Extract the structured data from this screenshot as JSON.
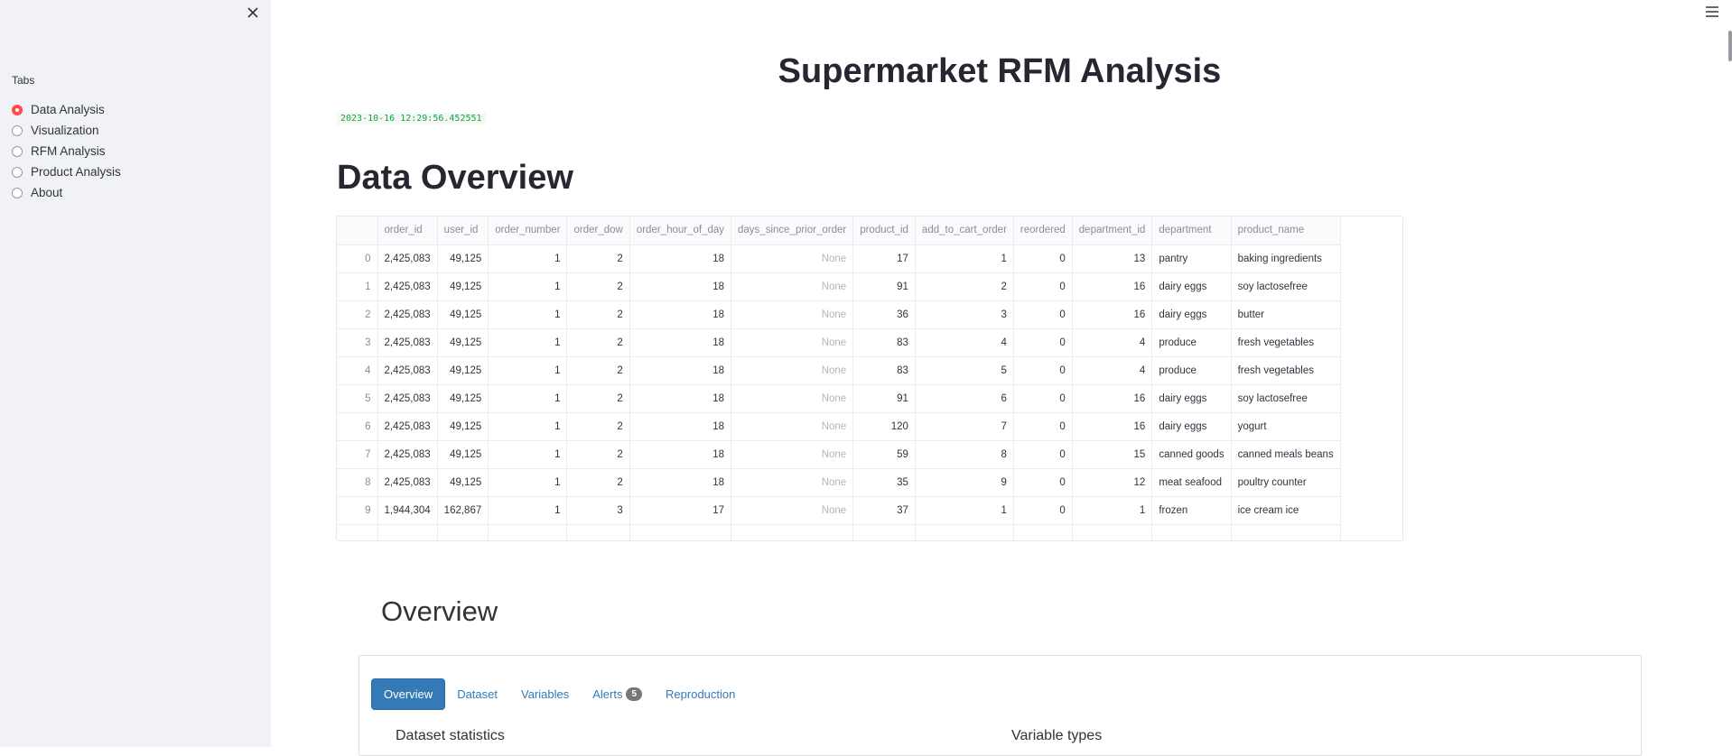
{
  "sidebar": {
    "tabs_label": "Tabs",
    "items": [
      {
        "label": "Data Analysis",
        "selected": true
      },
      {
        "label": "Visualization",
        "selected": false
      },
      {
        "label": "RFM Analysis",
        "selected": false
      },
      {
        "label": "Product Analysis",
        "selected": false
      },
      {
        "label": "About",
        "selected": false
      }
    ]
  },
  "main": {
    "title": "Supermarket RFM Analysis",
    "timestamp": "2023-10-16 12:29:56.452551",
    "section_title": "Data Overview"
  },
  "table": {
    "columns": [
      "",
      "order_id",
      "user_id",
      "order_number",
      "order_dow",
      "order_hour_of_day",
      "days_since_prior_order",
      "product_id",
      "add_to_cart_order",
      "reordered",
      "department_id",
      "department",
      "product_name"
    ],
    "rows": [
      [
        "0",
        "2,425,083",
        "49,125",
        "1",
        "2",
        "18",
        "None",
        "17",
        "1",
        "0",
        "13",
        "pantry",
        "baking ingredients"
      ],
      [
        "1",
        "2,425,083",
        "49,125",
        "1",
        "2",
        "18",
        "None",
        "91",
        "2",
        "0",
        "16",
        "dairy eggs",
        "soy lactosefree"
      ],
      [
        "2",
        "2,425,083",
        "49,125",
        "1",
        "2",
        "18",
        "None",
        "36",
        "3",
        "0",
        "16",
        "dairy eggs",
        "butter"
      ],
      [
        "3",
        "2,425,083",
        "49,125",
        "1",
        "2",
        "18",
        "None",
        "83",
        "4",
        "0",
        "4",
        "produce",
        "fresh vegetables"
      ],
      [
        "4",
        "2,425,083",
        "49,125",
        "1",
        "2",
        "18",
        "None",
        "83",
        "5",
        "0",
        "4",
        "produce",
        "fresh vegetables"
      ],
      [
        "5",
        "2,425,083",
        "49,125",
        "1",
        "2",
        "18",
        "None",
        "91",
        "6",
        "0",
        "16",
        "dairy eggs",
        "soy lactosefree"
      ],
      [
        "6",
        "2,425,083",
        "49,125",
        "1",
        "2",
        "18",
        "None",
        "120",
        "7",
        "0",
        "16",
        "dairy eggs",
        "yogurt"
      ],
      [
        "7",
        "2,425,083",
        "49,125",
        "1",
        "2",
        "18",
        "None",
        "59",
        "8",
        "0",
        "15",
        "canned goods",
        "canned meals beans"
      ],
      [
        "8",
        "2,425,083",
        "49,125",
        "1",
        "2",
        "18",
        "None",
        "35",
        "9",
        "0",
        "12",
        "meat seafood",
        "poultry counter"
      ],
      [
        "9",
        "1,944,304",
        "162,867",
        "1",
        "3",
        "17",
        "None",
        "37",
        "1",
        "0",
        "1",
        "frozen",
        "ice cream ice"
      ]
    ]
  },
  "report": {
    "heading": "Overview",
    "tabs": [
      {
        "label": "Overview",
        "active": true,
        "badge": ""
      },
      {
        "label": "Dataset",
        "active": false,
        "badge": ""
      },
      {
        "label": "Variables",
        "active": false,
        "badge": ""
      },
      {
        "label": "Alerts",
        "active": false,
        "badge": "5"
      },
      {
        "label": "Reproduction",
        "active": false,
        "badge": ""
      }
    ],
    "dataset_statistics": "Dataset statistics",
    "variable_types": "Variable types"
  },
  "colors": {
    "accent": "#ff4b4b",
    "link": "#337ab7",
    "code_green": "#09ab3b"
  },
  "icons": {
    "close": "close-icon",
    "menu": "hamburger-icon"
  }
}
